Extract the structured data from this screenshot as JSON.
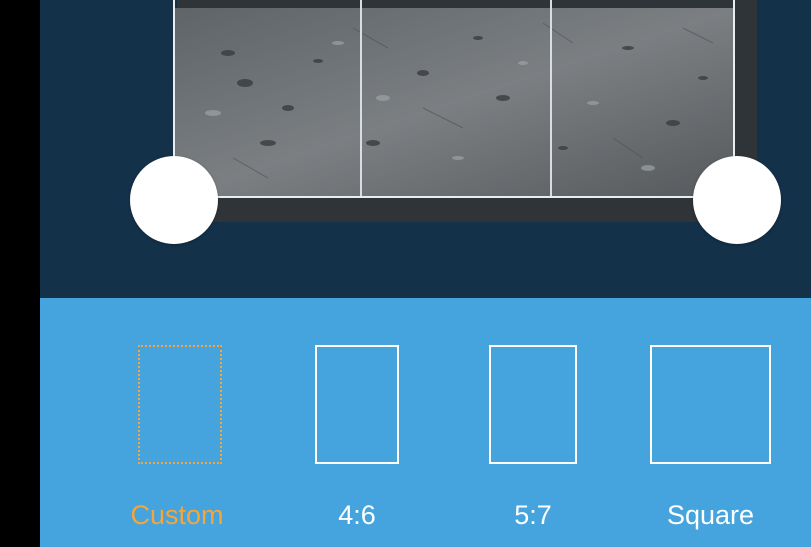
{
  "colors": {
    "canvas_background": "#14314a",
    "panel_background": "#45a3dd",
    "selected_accent": "#f5a637",
    "frame_color": "#ffffff",
    "handle_color": "#ffffff"
  },
  "crop_editor": {
    "photo_description": "image-preview",
    "handles": [
      "left-handle",
      "right-handle"
    ]
  },
  "aspect_options": [
    {
      "label": "Custom",
      "selected": true,
      "icon": "custom-frame-icon"
    },
    {
      "label": "4:6",
      "selected": false,
      "icon": "ratio-4-6-icon"
    },
    {
      "label": "5:7",
      "selected": false,
      "icon": "ratio-5-7-icon"
    },
    {
      "label": "Square",
      "selected": false,
      "icon": "square-frame-icon"
    }
  ]
}
